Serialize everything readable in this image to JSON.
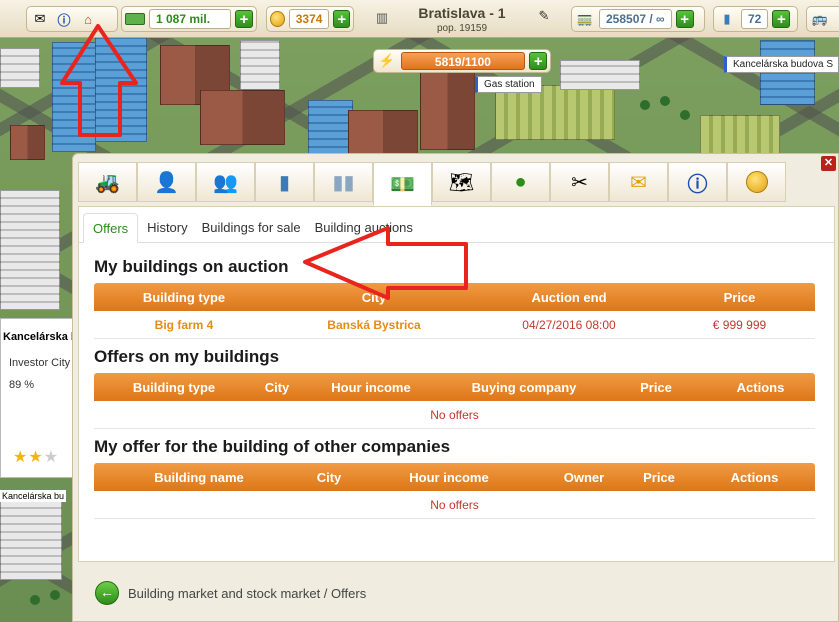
{
  "topbar": {
    "money": "1 087 mil.",
    "coins": "3374",
    "city_name": "Bratislava - 1",
    "population": "pop. 19159",
    "transport": "258507 / ∞",
    "buildings": "72",
    "energy": "5819/1100"
  },
  "map": {
    "tooltip_gas": "Gas station",
    "tooltip_office": "Kancelárska budova S"
  },
  "sidecard": {
    "title": "Kancelárska bud",
    "owner": "Investor City",
    "percent": "89 %",
    "label": "Kancelárska bu"
  },
  "dialog": {
    "icon_tabs": [
      "bulldozer-icon",
      "manager-icon",
      "people-icon",
      "building-icon",
      "towers-icon",
      "market-icon",
      "map-icon",
      "world-icon",
      "tools-icon",
      "mail-icon",
      "info-icon",
      "coin-icon"
    ],
    "subtabs": [
      "Offers",
      "History",
      "Buildings for sale",
      "Building auctions"
    ],
    "auction": {
      "title": "My buildings on auction",
      "headers": [
        "Building type",
        "City",
        "Auction end",
        "Price"
      ],
      "row": {
        "type": "Big farm 4",
        "city": "Banská Bystrica",
        "end": "04/27/2016 08:00",
        "price": "€ 999 999"
      }
    },
    "offers_mine": {
      "title": "Offers on my buildings",
      "headers": [
        "Building type",
        "City",
        "Hour income",
        "Buying company",
        "Price",
        "Actions"
      ],
      "empty": "No offers"
    },
    "offers_other": {
      "title": "My offer for the building of other companies",
      "headers": [
        "Building name",
        "City",
        "Hour income",
        "Owner",
        "Price",
        "Actions"
      ],
      "empty": "No offers"
    },
    "breadcrumb": "Building market and stock market / Offers"
  },
  "colors": {
    "accent_orange": "#e07a1a",
    "green": "#2f8a1f",
    "arrow_red": "#e8241c"
  }
}
